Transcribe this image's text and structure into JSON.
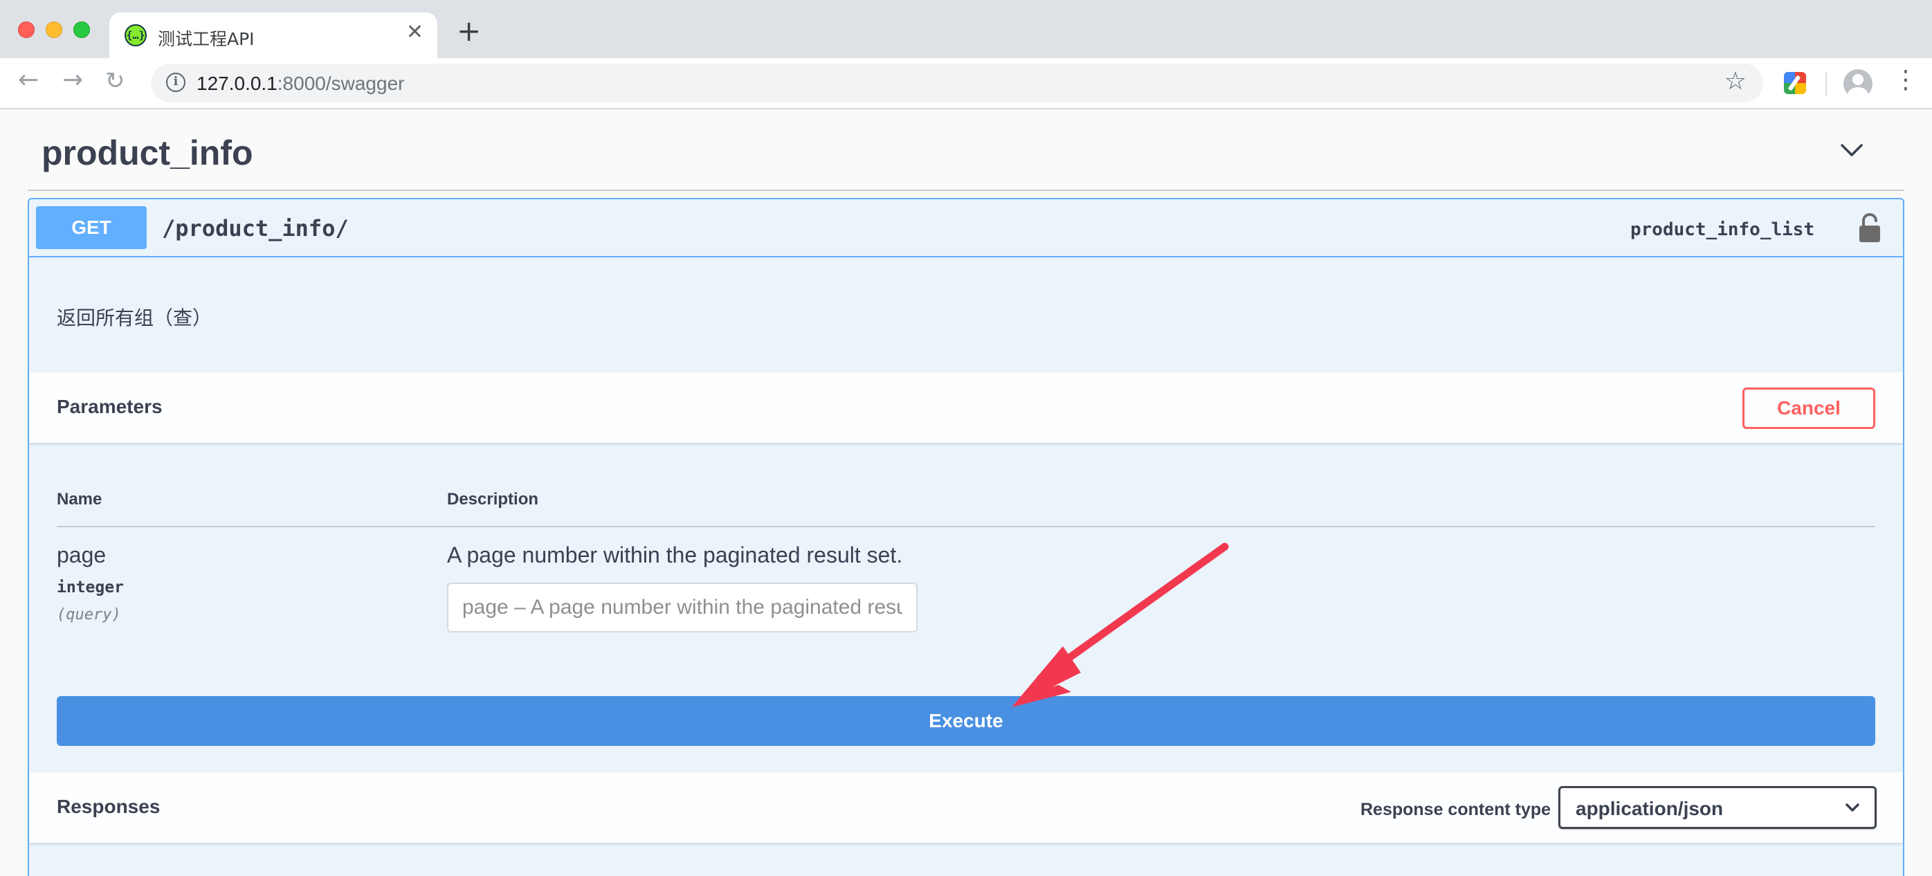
{
  "browser": {
    "tab_title": "测试工程API",
    "favicon_text": "{…}",
    "url_host": "127.0.0.1",
    "url_rest": ":8000/swagger",
    "icons": {
      "back": "arrow-left-icon",
      "forward": "arrow-right-icon",
      "reload": "reload-icon",
      "info": "info-icon",
      "bookmark": "star-icon",
      "extension": "extension-icon",
      "profile": "avatar-icon",
      "menu": "kebab-menu-icon"
    }
  },
  "section": {
    "title": "product_info"
  },
  "operation": {
    "method": "GET",
    "path": "/product_info/",
    "operation_id": "product_info_list",
    "description": "返回所有组（查）"
  },
  "parameters": {
    "title": "Parameters",
    "cancel_label": "Cancel",
    "col_name": "Name",
    "col_description": "Description",
    "items": [
      {
        "name": "page",
        "type": "integer",
        "in": "(query)",
        "description": "A page number within the paginated result set.",
        "placeholder": "page – A page number within the paginated result set."
      }
    ]
  },
  "execute_label": "Execute",
  "responses": {
    "title": "Responses",
    "content_type_label": "Response content type",
    "content_type_value": "application/json"
  },
  "colors": {
    "get_blue": "#61affe",
    "execute_blue": "#4990e2",
    "cancel_red": "#ff6060",
    "annotation_red": "#f2384f"
  }
}
